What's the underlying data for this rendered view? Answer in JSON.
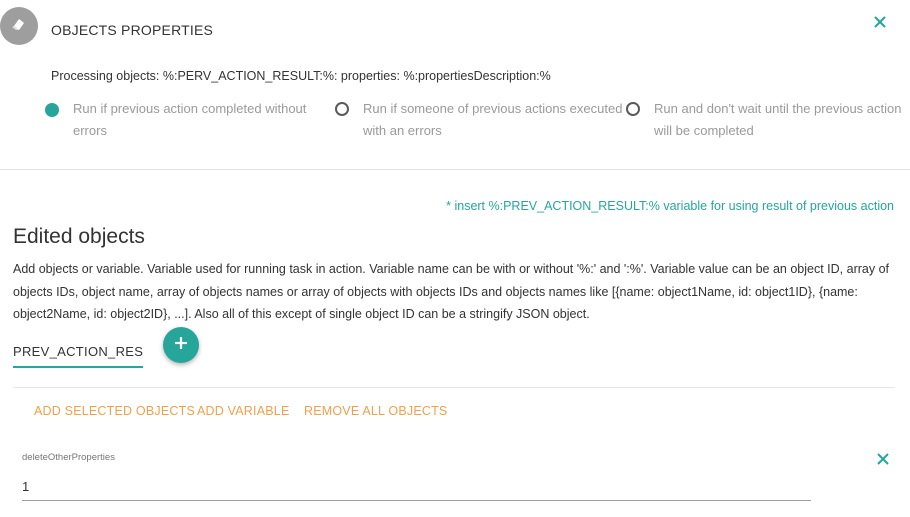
{
  "header": {
    "title": "OBJECTS PROPERTIES",
    "avatar_icon": "cube-icon",
    "close_icon": "close-icon"
  },
  "processing_text": "Processing objects: %:PERV_ACTION_RESULT:%: properties: %:propertiesDescription:%",
  "run_options": [
    {
      "line1": "Run if previous action completed without",
      "line2": "errors",
      "checked": true
    },
    {
      "line1": "Run if someone of previous actions executed",
      "line2": "with an errors",
      "checked": false
    },
    {
      "line1": "Run and don't wait until the previous action",
      "line2": "will be completed",
      "checked": false
    }
  ],
  "insert_hint": "* insert %:PREV_ACTION_RESULT:% variable for using result of previous action",
  "edited_objects": {
    "title": "Edited objects",
    "description": "Add objects or variable. Variable used for running task in action. Variable name can be with or without '%:' and ':%'. Variable value can be an object ID, array of objects IDs, object name, array of objects names or array of objects with objects IDs and objects names like [{name: object1Name, id: object1ID}, {name: object2Name, id: object2ID}, ...]. Also all of this except of single object ID can be a stringify JSON object.",
    "variable_value": "PREV_ACTION_RESU",
    "add_icon": "plus-icon"
  },
  "actions": {
    "add_selected": "ADD SELECTED OBJECTS",
    "add_variable": "ADD VARIABLE",
    "remove_all": "REMOVE ALL OBJECTS"
  },
  "property_field": {
    "label": "deleteOtherProperties",
    "value": "1"
  },
  "colors": {
    "accent": "#26a69a",
    "action": "#f0a04b",
    "muted": "#9a9a9a",
    "avatar_bg": "#9e9e9e"
  }
}
